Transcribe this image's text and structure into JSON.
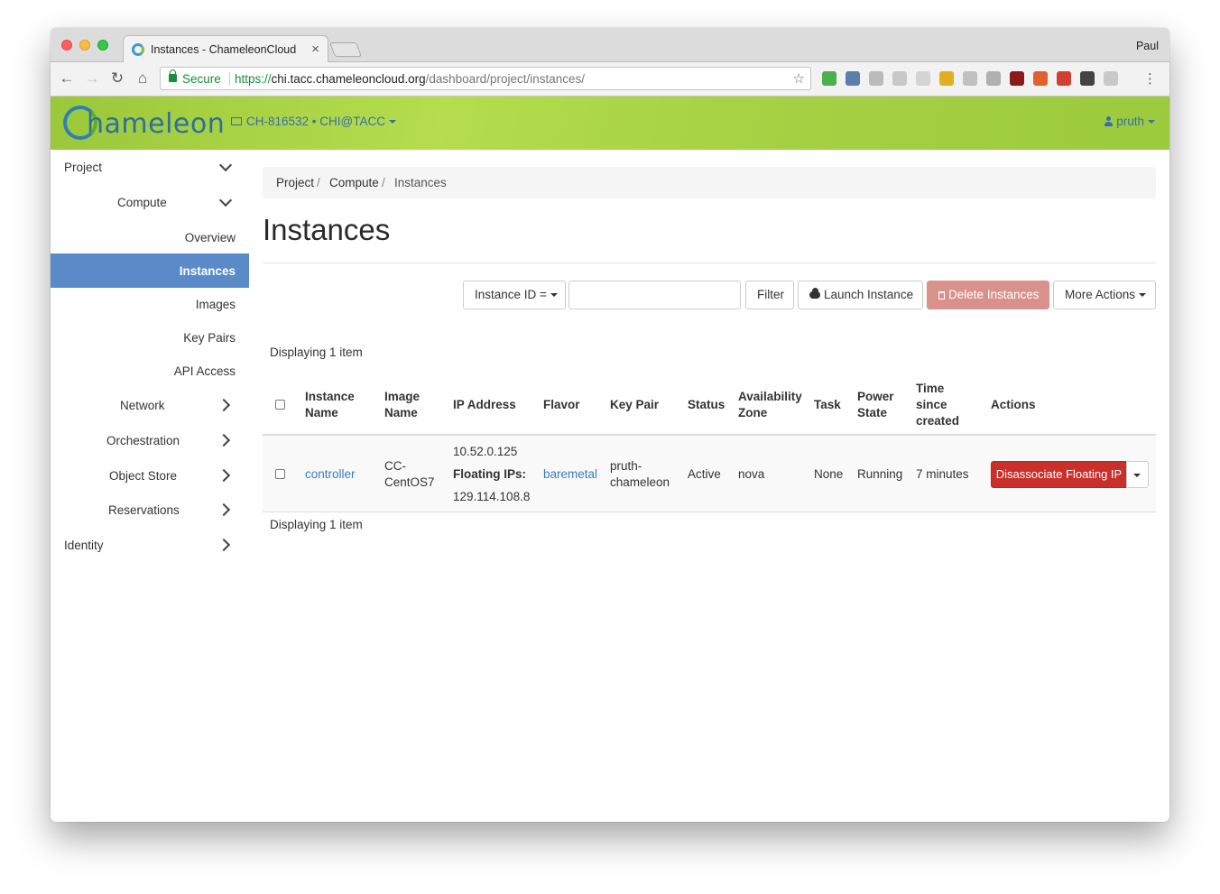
{
  "browser": {
    "tab_title": "Instances - ChameleonCloud",
    "tab_close": "×",
    "profile_name": "Paul",
    "security_label": "Secure",
    "url_scheme": "https://",
    "url_host": "chi.tacc.chameleoncloud.org",
    "url_path": "/dashboard/project/instances/",
    "back": "←",
    "forward": "→",
    "reload": "↻",
    "home": "⌂",
    "star": "☆",
    "menu": "⋮",
    "extensions": [
      "#4caf50",
      "#5d7ea8",
      "#bbbbbb",
      "#c8c8c8",
      "#d4d4d4",
      "#e0b020",
      "#c0c0c0",
      "#b0b0b0",
      "#8b1a1a",
      "#e06030",
      "#d04030",
      "#444444",
      "#c8c8c8"
    ]
  },
  "header": {
    "logo_text": "hameleon",
    "project": "CH-816532 • CHI@TACC",
    "user": "pruth",
    "colors": {
      "bar": "#a6d244",
      "link": "#3a6ea8"
    }
  },
  "sidebar": {
    "items": [
      {
        "label": "Project",
        "chevron": "down"
      },
      {
        "label": "Compute",
        "chevron": "down"
      },
      {
        "label": "Overview"
      },
      {
        "label": "Instances",
        "active": true
      },
      {
        "label": "Images"
      },
      {
        "label": "Key Pairs"
      },
      {
        "label": "API Access"
      },
      {
        "label": "Network",
        "chevron": "right"
      },
      {
        "label": "Orchestration",
        "chevron": "right"
      },
      {
        "label": "Object Store",
        "chevron": "right"
      },
      {
        "label": "Reservations",
        "chevron": "right"
      },
      {
        "label": "Identity",
        "chevron": "right"
      }
    ],
    "active_color": "#5a8ac8"
  },
  "breadcrumb": [
    "Project",
    "Compute",
    "Instances"
  ],
  "page_title": "Instances",
  "actions": {
    "filter_select": "Instance ID =",
    "filter_value": "",
    "filter_button": "Filter",
    "launch_button": "Launch Instance",
    "delete_button": "Delete Instances",
    "more_button": "More Actions"
  },
  "table": {
    "count_label": "Displaying 1 item",
    "headers": {
      "name": [
        "Instance",
        "Name"
      ],
      "image": [
        "Image",
        "Name"
      ],
      "ip": [
        "IP Address"
      ],
      "flavor": [
        "Flavor"
      ],
      "keypair": [
        "Key Pair"
      ],
      "status": [
        "Status"
      ],
      "zone": [
        "Availability",
        "Zone"
      ],
      "task": [
        "Task"
      ],
      "power": [
        "Power",
        "State"
      ],
      "time": [
        "Time",
        "since",
        "created"
      ],
      "actions": [
        "Actions"
      ]
    },
    "rows": [
      {
        "name": "controller",
        "image": [
          "CC-",
          "CentOS7"
        ],
        "ip_fixed": "10.52.0.125",
        "ip_floating_label": "Floating IPs:",
        "ip_floating": "129.114.108.8",
        "flavor": "baremetal",
        "keypair": [
          "pruth-",
          "chameleon"
        ],
        "status": "Active",
        "zone": "nova",
        "task": "None",
        "power": "Running",
        "time": "7 minutes",
        "action": "Disassociate Floating IP"
      }
    ],
    "danger_color": "#c9302c"
  }
}
